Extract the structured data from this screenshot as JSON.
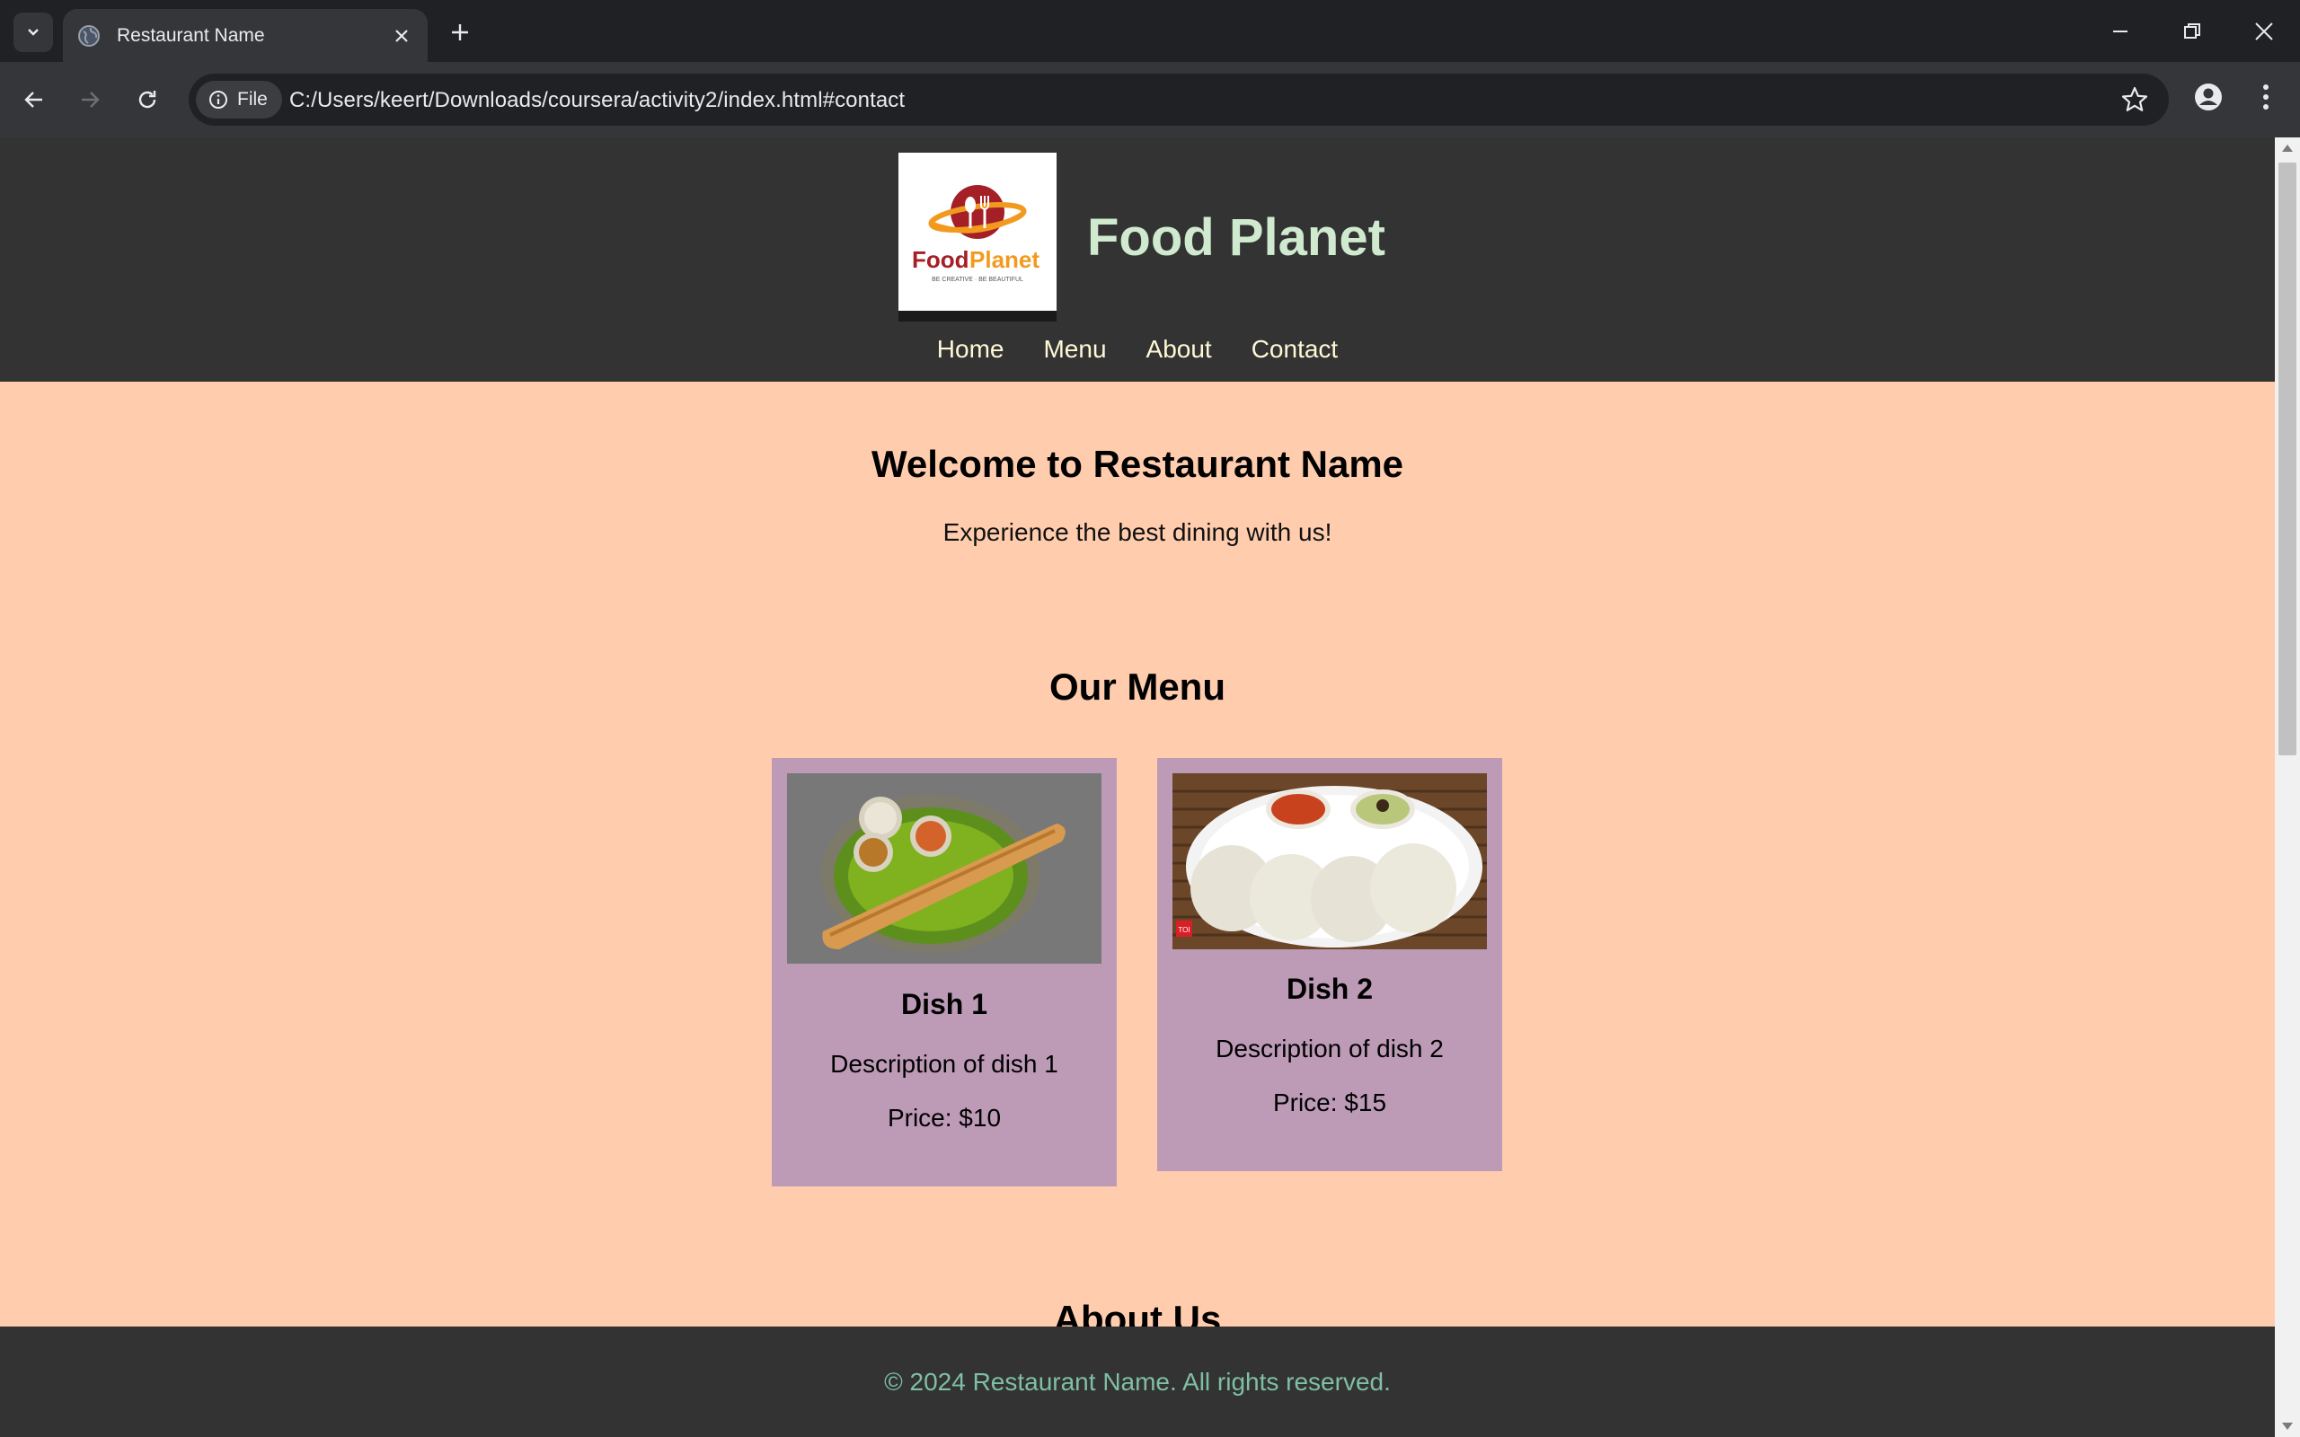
{
  "browser": {
    "tab_title": "Restaurant Name",
    "url": "C:/Users/keert/Downloads/coursera/activity2/index.html#contact",
    "security_chip": "File"
  },
  "site": {
    "title": "Food Planet",
    "logo": {
      "text_food": "Food",
      "text_planet": "Planet",
      "tagline": "BE CREATIVE · BE BEAUTIFUL"
    },
    "nav": [
      "Home",
      "Menu",
      "About",
      "Contact"
    ]
  },
  "hero": {
    "heading": "Welcome to Restaurant Name",
    "subheading": "Experience the best dining with us!"
  },
  "menu": {
    "heading": "Our Menu",
    "items": [
      {
        "name": "Dish 1",
        "description": "Description of dish 1",
        "price": "Price: $10"
      },
      {
        "name": "Dish 2",
        "description": "Description of dish 2",
        "price": "Price: $15"
      }
    ]
  },
  "about": {
    "heading": "About Us"
  },
  "footer": {
    "text": "© 2024 Restaurant Name. All rights reserved."
  },
  "colors": {
    "page_bg": "#ffcdad",
    "header_bg": "#333333",
    "card_bg": "#bd9bb7",
    "title_color": "#cfeacf",
    "footer_text": "#7fbfa5"
  }
}
